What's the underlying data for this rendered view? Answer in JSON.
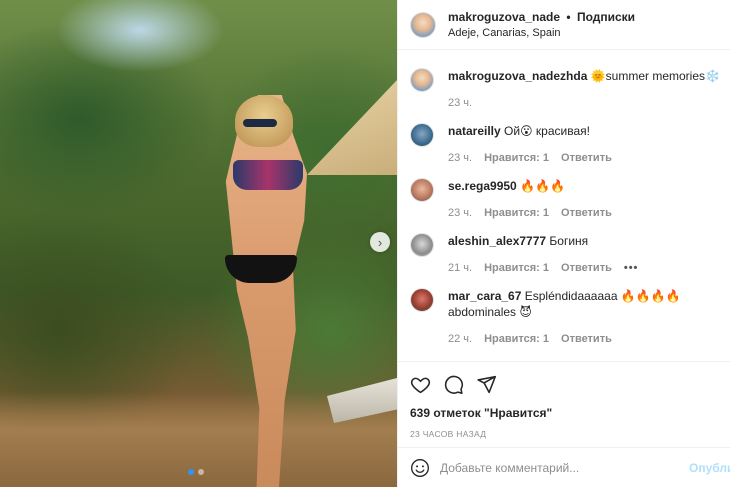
{
  "header": {
    "username": "makroguzova_nade",
    "separator": "•",
    "follow": "Подписки",
    "location": "Adeje, Canarias, Spain"
  },
  "caption": {
    "username": "makroguzova_nadezhda",
    "text": "🌞summer memories❄️",
    "time": "23 ч."
  },
  "comments": [
    {
      "username": "natareilly",
      "text": "Ой😮 красивая!",
      "time": "23 ч.",
      "likes": "Нравится: 1",
      "reply": "Ответить"
    },
    {
      "username": "se.rega9950",
      "text": "🔥🔥🔥",
      "time": "23 ч.",
      "likes": "Нравится: 1",
      "reply": "Ответить"
    },
    {
      "username": "aleshin_alex7777",
      "text": "Богиня",
      "time": "21 ч.",
      "likes": "Нравится: 1",
      "reply": "Ответить",
      "more": "•••"
    },
    {
      "username": "mar_cara_67",
      "text": "Espléndidaaaaaa 🔥🔥🔥🔥 abdominales 😈",
      "time": "22 ч.",
      "likes": "Нравится: 1",
      "reply": "Ответить"
    }
  ],
  "actions": {
    "likes_text": "639 отметок \"Нравится\"",
    "posted_time": "23 ЧАСОВ НАЗАД"
  },
  "comment_box": {
    "placeholder": "Добавьте комментарий...",
    "post_label": "Опубликовать"
  },
  "icons": {
    "like": "heart-icon",
    "comment": "comment-bubble-icon",
    "share": "paper-plane-icon",
    "emoji": "emoji-smiley-icon",
    "next": "chevron-right-icon"
  },
  "colors": {
    "accent": "#0095f6",
    "post_disabled": "#b2dffc",
    "muted": "#8e8e8e"
  },
  "carousel": {
    "count": 2,
    "active": 1
  }
}
